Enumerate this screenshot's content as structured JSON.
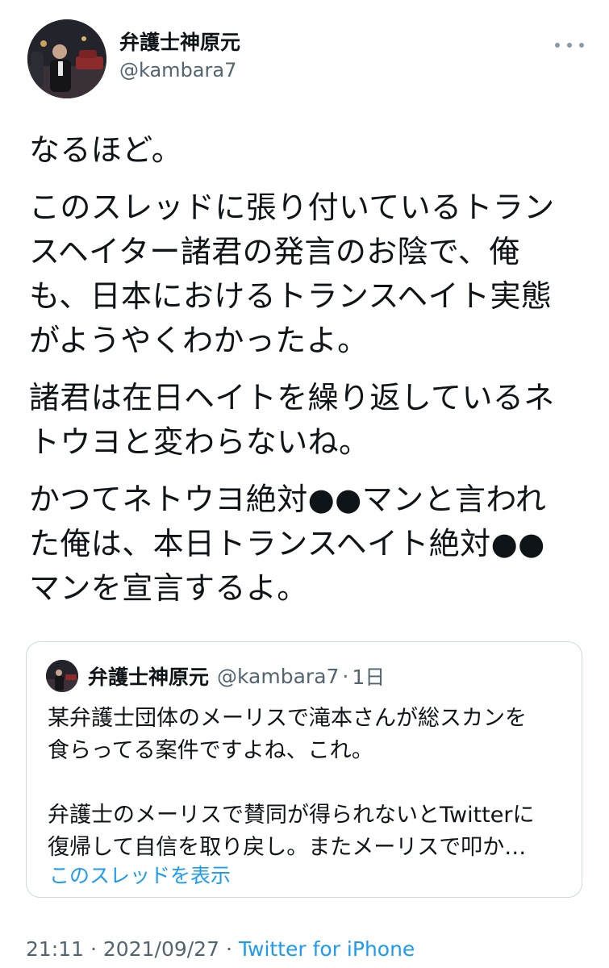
{
  "author": {
    "display_name": "弁護士神原元",
    "handle": "@kambara7",
    "avatar_icon": "profile-photo-icon"
  },
  "tweet": {
    "paragraphs": [
      "なるほど。",
      "このスレッドに張り付いているトラン\nスヘイター諸君の発言のお陰で、俺\nも、日本におけるトランスヘイト実態\nがようやくわかったよ。",
      "諸君は在日ヘイトを繰り返しているネ\nトウヨと変わらないね。",
      "かつてネトウヨ絶対●●マンと言われ\nた俺は、本日トランスヘイト絶対●●\nマンを宣言するよ。"
    ]
  },
  "quote": {
    "display_name": "弁護士神原元",
    "handle": "@kambara7",
    "separator": "·",
    "time": "1日",
    "paragraphs": [
      "某弁護士団体のメーリスで滝本さんが総スカンを\n食らってる案件ですよね、これ。",
      "弁護士のメーリスで賛同が得られないとTwitterに\n復帰して自信を取り戻し。またメーリスで叩か…"
    ],
    "show_thread_label": "このスレッドを表示"
  },
  "meta": {
    "time": "21:11",
    "separator": "·",
    "date": "2021/09/27",
    "source": "Twitter for iPhone"
  },
  "colors": {
    "text": "#0f1419",
    "secondary": "#536471",
    "link": "#1d9bf0",
    "border": "#cfd9de"
  }
}
